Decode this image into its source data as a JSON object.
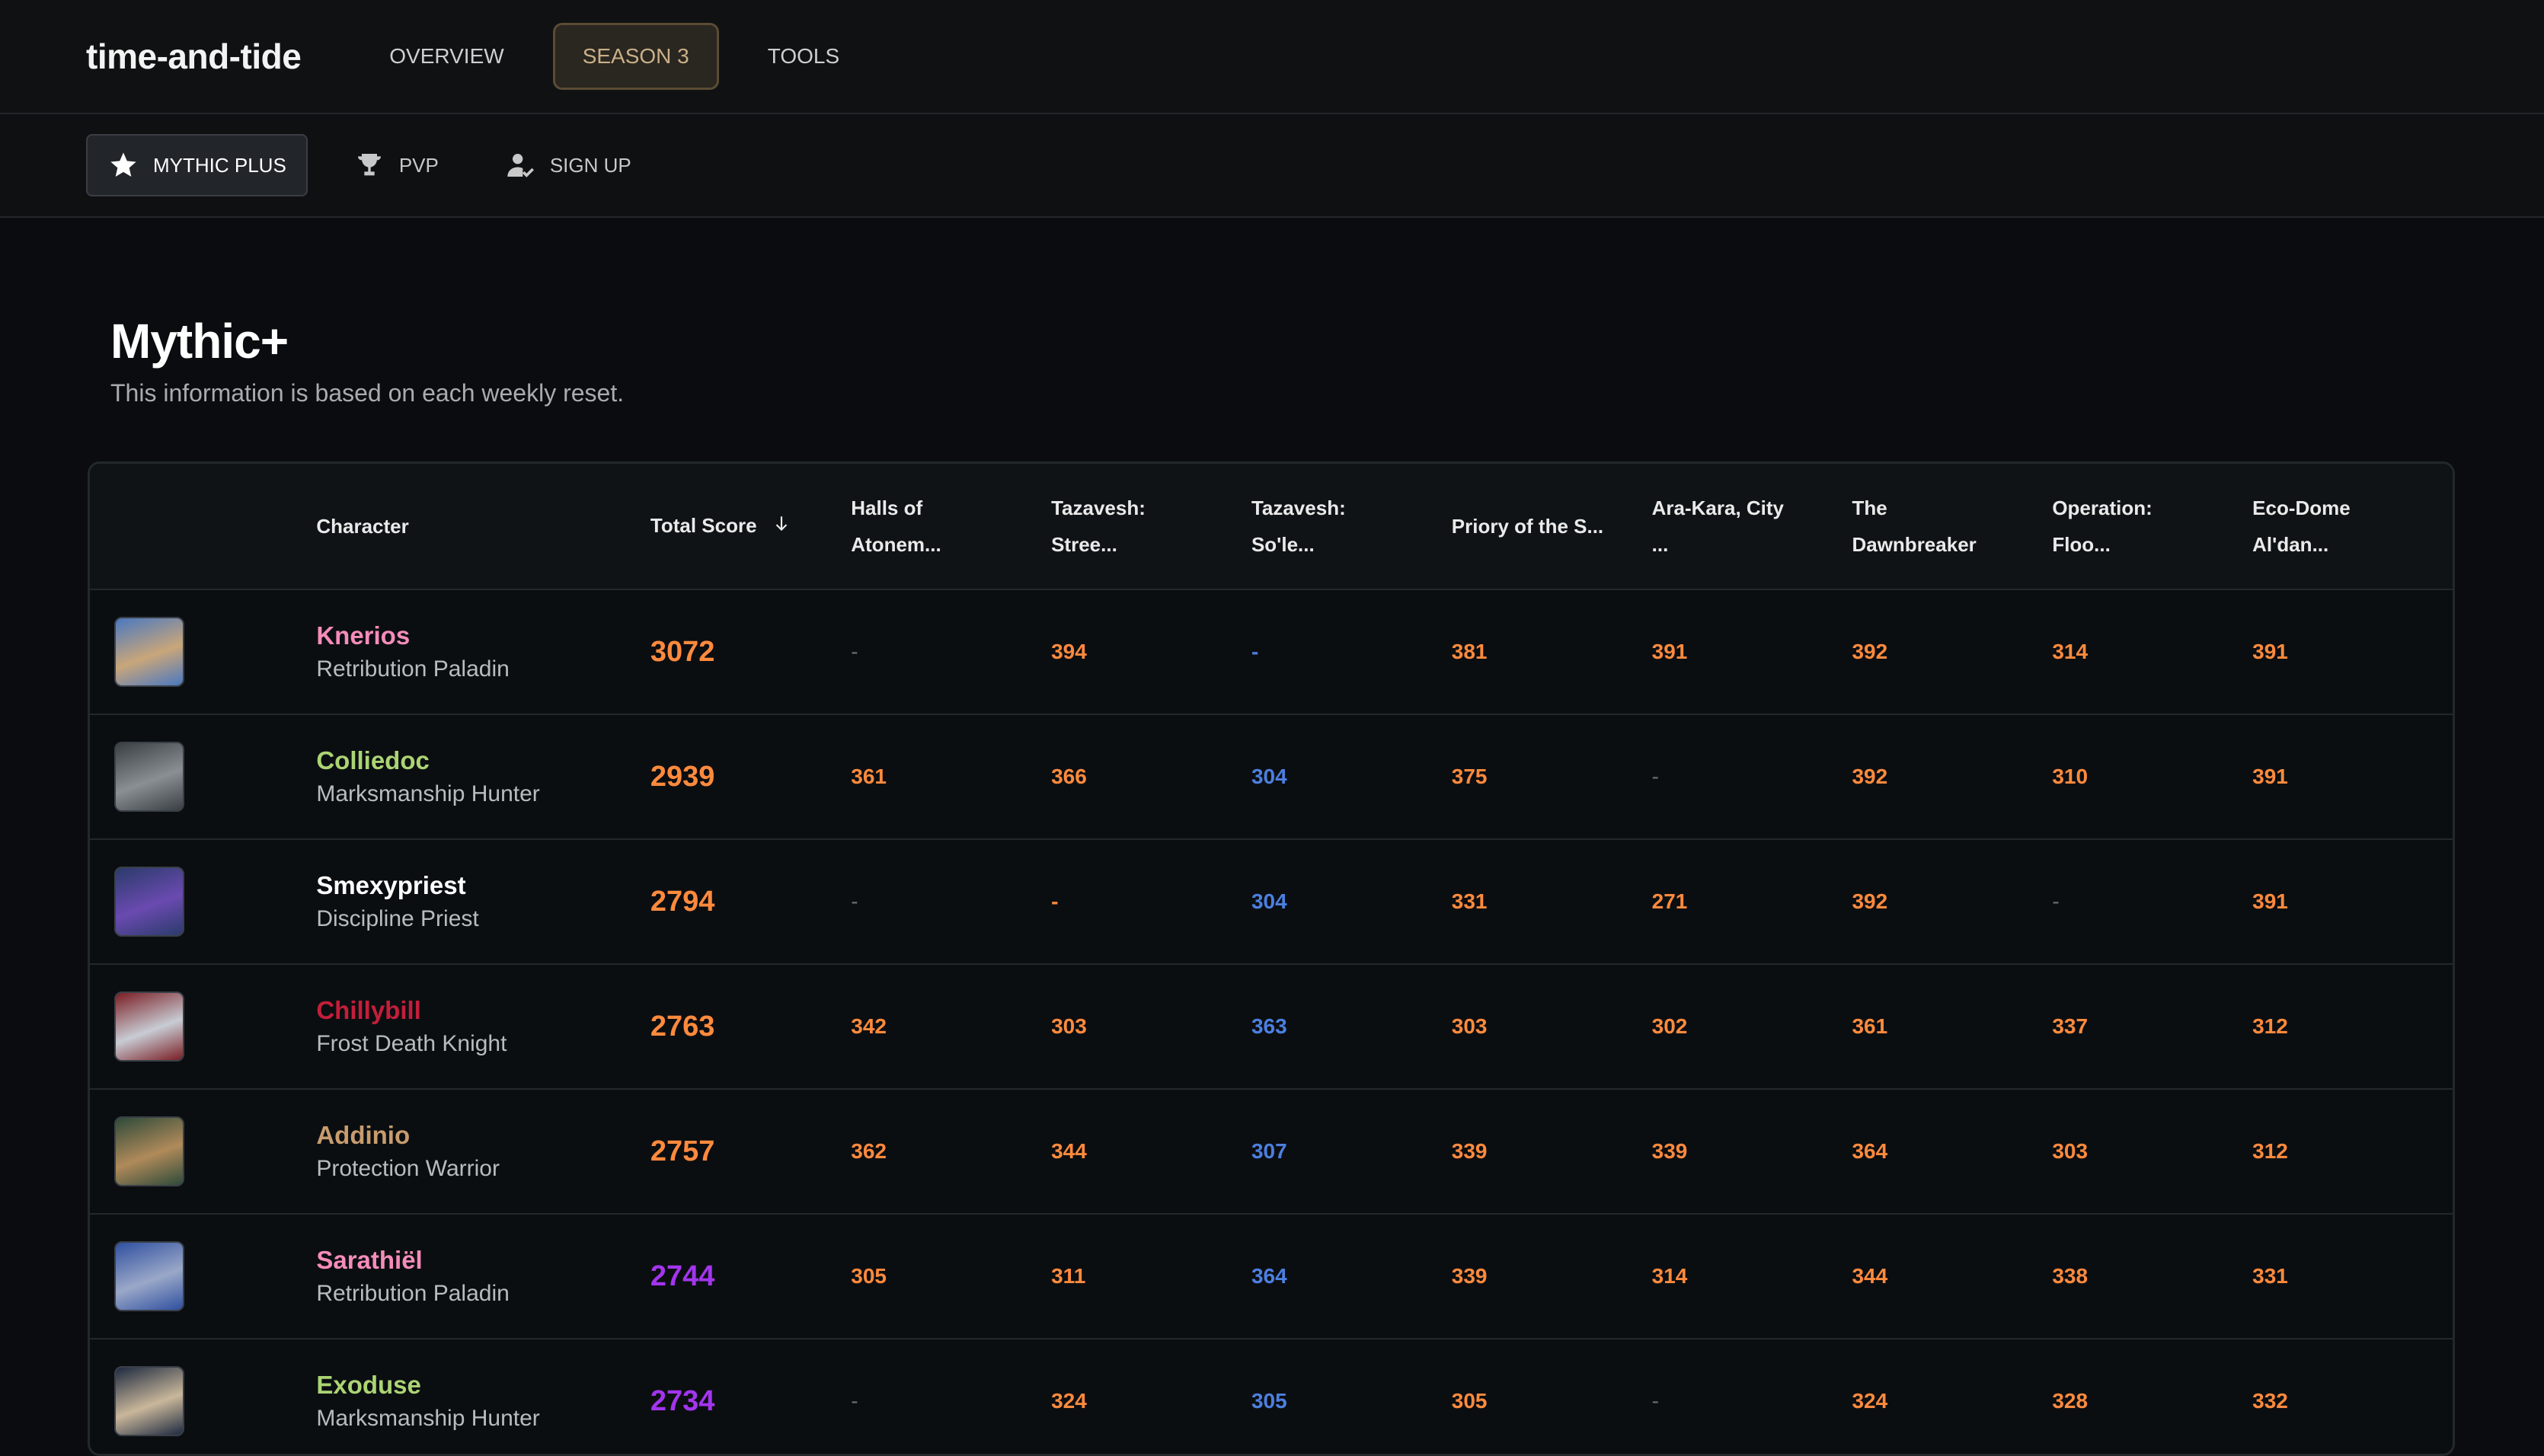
{
  "app": {
    "title": "time-and-tide"
  },
  "nav": {
    "tabs": [
      {
        "label": "OVERVIEW"
      },
      {
        "label": "SEASON 3"
      },
      {
        "label": "TOOLS"
      }
    ]
  },
  "subnav": {
    "tabs": [
      {
        "label": "MYTHIC PLUS",
        "icon": "star-icon"
      },
      {
        "label": "PVP",
        "icon": "trophy-icon"
      },
      {
        "label": "SIGN UP",
        "icon": "user-check-icon"
      }
    ]
  },
  "page": {
    "title": "Mythic+",
    "subtitle": "This information is based on each weekly reset."
  },
  "table": {
    "columns": {
      "character": "Character",
      "total": "Total Score",
      "dungeons": [
        [
          "Halls of",
          "Atonem..."
        ],
        [
          "Tazavesh:",
          "Stree..."
        ],
        [
          "Tazavesh:",
          "So'le..."
        ],
        [
          "Priory of the S..."
        ],
        [
          "Ara-Kara, City",
          "..."
        ],
        [
          "The",
          "Dawnbreaker"
        ],
        [
          "Operation:",
          "Floo..."
        ],
        [
          "Eco-Dome",
          "Al'dan..."
        ]
      ]
    },
    "rows": [
      {
        "name": "Knerios",
        "spec": "Retribution Paladin",
        "name_color": "#f58cba",
        "avatar_colors": [
          "#4a78c0",
          "#c9a67a"
        ],
        "total": "3072",
        "total_color": "#ff8a3d",
        "scores": [
          {
            "v": "-",
            "c": "#6b6f74"
          },
          {
            "v": "394",
            "c": "#ff8a3d"
          },
          {
            "v": "-",
            "c": "#4c7fe0"
          },
          {
            "v": "381",
            "c": "#ff8a3d"
          },
          {
            "v": "391",
            "c": "#ff8a3d"
          },
          {
            "v": "392",
            "c": "#ff8a3d"
          },
          {
            "v": "314",
            "c": "#ff8a3d"
          },
          {
            "v": "391",
            "c": "#ff8a3d"
          }
        ]
      },
      {
        "name": "Colliedoc",
        "spec": "Marksmanship Hunter",
        "name_color": "#abd473",
        "avatar_colors": [
          "#3a3f44",
          "#8a8f94"
        ],
        "total": "2939",
        "total_color": "#ff8a3d",
        "scores": [
          {
            "v": "361",
            "c": "#ff8a3d"
          },
          {
            "v": "366",
            "c": "#ff8a3d"
          },
          {
            "v": "304",
            "c": "#4c7fe0"
          },
          {
            "v": "375",
            "c": "#ff8a3d"
          },
          {
            "v": "-",
            "c": "#6b6f74"
          },
          {
            "v": "392",
            "c": "#ff8a3d"
          },
          {
            "v": "310",
            "c": "#ff8a3d"
          },
          {
            "v": "391",
            "c": "#ff8a3d"
          }
        ]
      },
      {
        "name": "Smexypriest",
        "spec": "Discipline Priest",
        "name_color": "#ffffff",
        "avatar_colors": [
          "#2b3b6b",
          "#6a4ab0"
        ],
        "total": "2794",
        "total_color": "#ff8a3d",
        "scores": [
          {
            "v": "-",
            "c": "#6b6f74"
          },
          {
            "v": "-",
            "c": "#ff8a3d"
          },
          {
            "v": "304",
            "c": "#4c7fe0"
          },
          {
            "v": "331",
            "c": "#ff8a3d"
          },
          {
            "v": "271",
            "c": "#ff8a3d"
          },
          {
            "v": "392",
            "c": "#ff8a3d"
          },
          {
            "v": "-",
            "c": "#6b6f74"
          },
          {
            "v": "391",
            "c": "#ff8a3d"
          }
        ]
      },
      {
        "name": "Chillybill",
        "spec": "Frost Death Knight",
        "name_color": "#c41e3a",
        "avatar_colors": [
          "#7a1e24",
          "#c8ccd4"
        ],
        "total": "2763",
        "total_color": "#ff8a3d",
        "scores": [
          {
            "v": "342",
            "c": "#ff8a3d"
          },
          {
            "v": "303",
            "c": "#ff8a3d"
          },
          {
            "v": "363",
            "c": "#4c7fe0"
          },
          {
            "v": "303",
            "c": "#ff8a3d"
          },
          {
            "v": "302",
            "c": "#ff8a3d"
          },
          {
            "v": "361",
            "c": "#ff8a3d"
          },
          {
            "v": "337",
            "c": "#ff8a3d"
          },
          {
            "v": "312",
            "c": "#ff8a3d"
          }
        ]
      },
      {
        "name": "Addinio",
        "spec": "Protection Warrior",
        "name_color": "#c79c6e",
        "avatar_colors": [
          "#2e4a3a",
          "#b08a5a"
        ],
        "total": "2757",
        "total_color": "#ff8a3d",
        "scores": [
          {
            "v": "362",
            "c": "#ff8a3d"
          },
          {
            "v": "344",
            "c": "#ff8a3d"
          },
          {
            "v": "307",
            "c": "#4c7fe0"
          },
          {
            "v": "339",
            "c": "#ff8a3d"
          },
          {
            "v": "339",
            "c": "#ff8a3d"
          },
          {
            "v": "364",
            "c": "#ff8a3d"
          },
          {
            "v": "303",
            "c": "#ff8a3d"
          },
          {
            "v": "312",
            "c": "#ff8a3d"
          }
        ]
      },
      {
        "name": "Sarathiël",
        "spec": "Retribution Paladin",
        "name_color": "#f58cba",
        "avatar_colors": [
          "#3050a0",
          "#9aa8c8"
        ],
        "total": "2744",
        "total_color": "#a335ee",
        "scores": [
          {
            "v": "305",
            "c": "#ff8a3d"
          },
          {
            "v": "311",
            "c": "#ff8a3d"
          },
          {
            "v": "364",
            "c": "#4c7fe0"
          },
          {
            "v": "339",
            "c": "#ff8a3d"
          },
          {
            "v": "314",
            "c": "#ff8a3d"
          },
          {
            "v": "344",
            "c": "#ff8a3d"
          },
          {
            "v": "338",
            "c": "#ff8a3d"
          },
          {
            "v": "331",
            "c": "#ff8a3d"
          }
        ]
      },
      {
        "name": "Exoduse",
        "spec": "Marksmanship Hunter",
        "name_color": "#abd473",
        "avatar_colors": [
          "#1e2a40",
          "#c9b79a"
        ],
        "total": "2734",
        "total_color": "#a335ee",
        "scores": [
          {
            "v": "-",
            "c": "#6b6f74"
          },
          {
            "v": "324",
            "c": "#ff8a3d"
          },
          {
            "v": "305",
            "c": "#4c7fe0"
          },
          {
            "v": "305",
            "c": "#ff8a3d"
          },
          {
            "v": "-",
            "c": "#6b6f74"
          },
          {
            "v": "324",
            "c": "#ff8a3d"
          },
          {
            "v": "328",
            "c": "#ff8a3d"
          },
          {
            "v": "332",
            "c": "#ff8a3d"
          }
        ]
      }
    ]
  }
}
